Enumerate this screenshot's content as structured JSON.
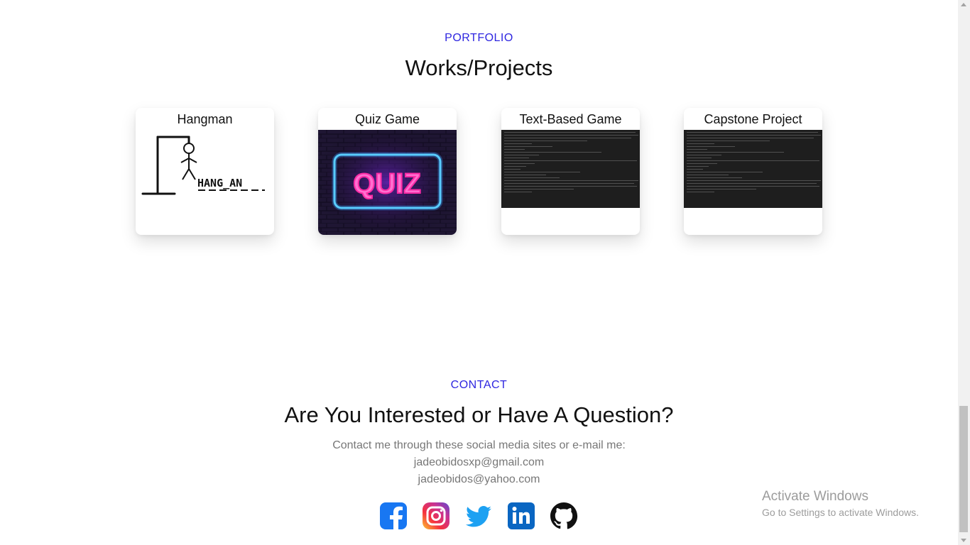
{
  "portfolio": {
    "eyebrow": "PORTFOLIO",
    "heading": "Works/Projects",
    "projects": [
      {
        "title": "Hangman",
        "image_text": "HANG_AN"
      },
      {
        "title": "Quiz Game",
        "image_text": "QUIZ"
      },
      {
        "title": "Text-Based Game"
      },
      {
        "title": "Capstone Project"
      }
    ]
  },
  "contact": {
    "eyebrow": "CONTACT",
    "heading": "Are You Interested or Have A Question?",
    "intro": "Contact me through these social media sites or e-mail me:",
    "emails": [
      "jadeobidosxp@gmail.com",
      "jadeobidos@yahoo.com"
    ],
    "socials": [
      "facebook-icon",
      "instagram-icon",
      "twitter-icon",
      "linkedin-icon",
      "github-icon"
    ]
  },
  "activation": {
    "title": "Activate Windows",
    "subtitle": "Go to Settings to activate Windows."
  },
  "colors": {
    "accent": "#2e26e0",
    "facebook": "#1877f2",
    "twitter": "#1da1f2",
    "linkedin": "#0a66c2",
    "github": "#111111"
  }
}
